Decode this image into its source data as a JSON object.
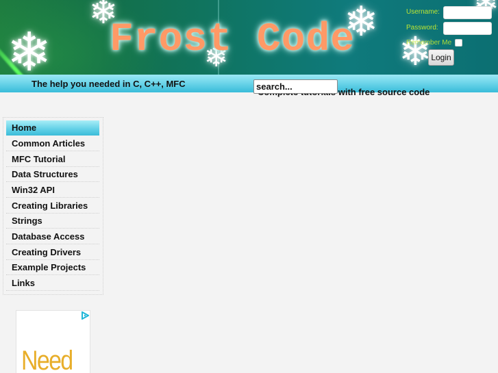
{
  "header": {
    "logo_text": "Frost Code",
    "login": {
      "username_label": "Username:",
      "username_value": "",
      "password_label": "Password:",
      "password_value": "",
      "remember_label": "Remember Me",
      "remember_checked": false,
      "login_button": "Login"
    }
  },
  "tagbar": {
    "tagline": "The help you needed in C, C++, MFC",
    "subtagline": "Complete tutorials with free source code",
    "search_value": "search..."
  },
  "menu": {
    "items": [
      {
        "label": "Home",
        "active": true
      },
      {
        "label": "Common Articles"
      },
      {
        "label": "MFC Tutorial"
      },
      {
        "label": "Data Structures"
      },
      {
        "label": "Win32 API"
      },
      {
        "label": "Creating Libraries"
      },
      {
        "label": "Strings"
      },
      {
        "label": "Database Access"
      },
      {
        "label": "Creating Drivers"
      },
      {
        "label": "Example Projects"
      },
      {
        "label": "Links"
      }
    ]
  },
  "ad": {
    "text": "Need",
    "icon": "adchoices-icon"
  },
  "colors": {
    "accent_cyan": "#5fcfe6",
    "logo_orange": "#ff9966",
    "login_label_green": "#bfe632",
    "ad_text": "#e8ae2a"
  }
}
